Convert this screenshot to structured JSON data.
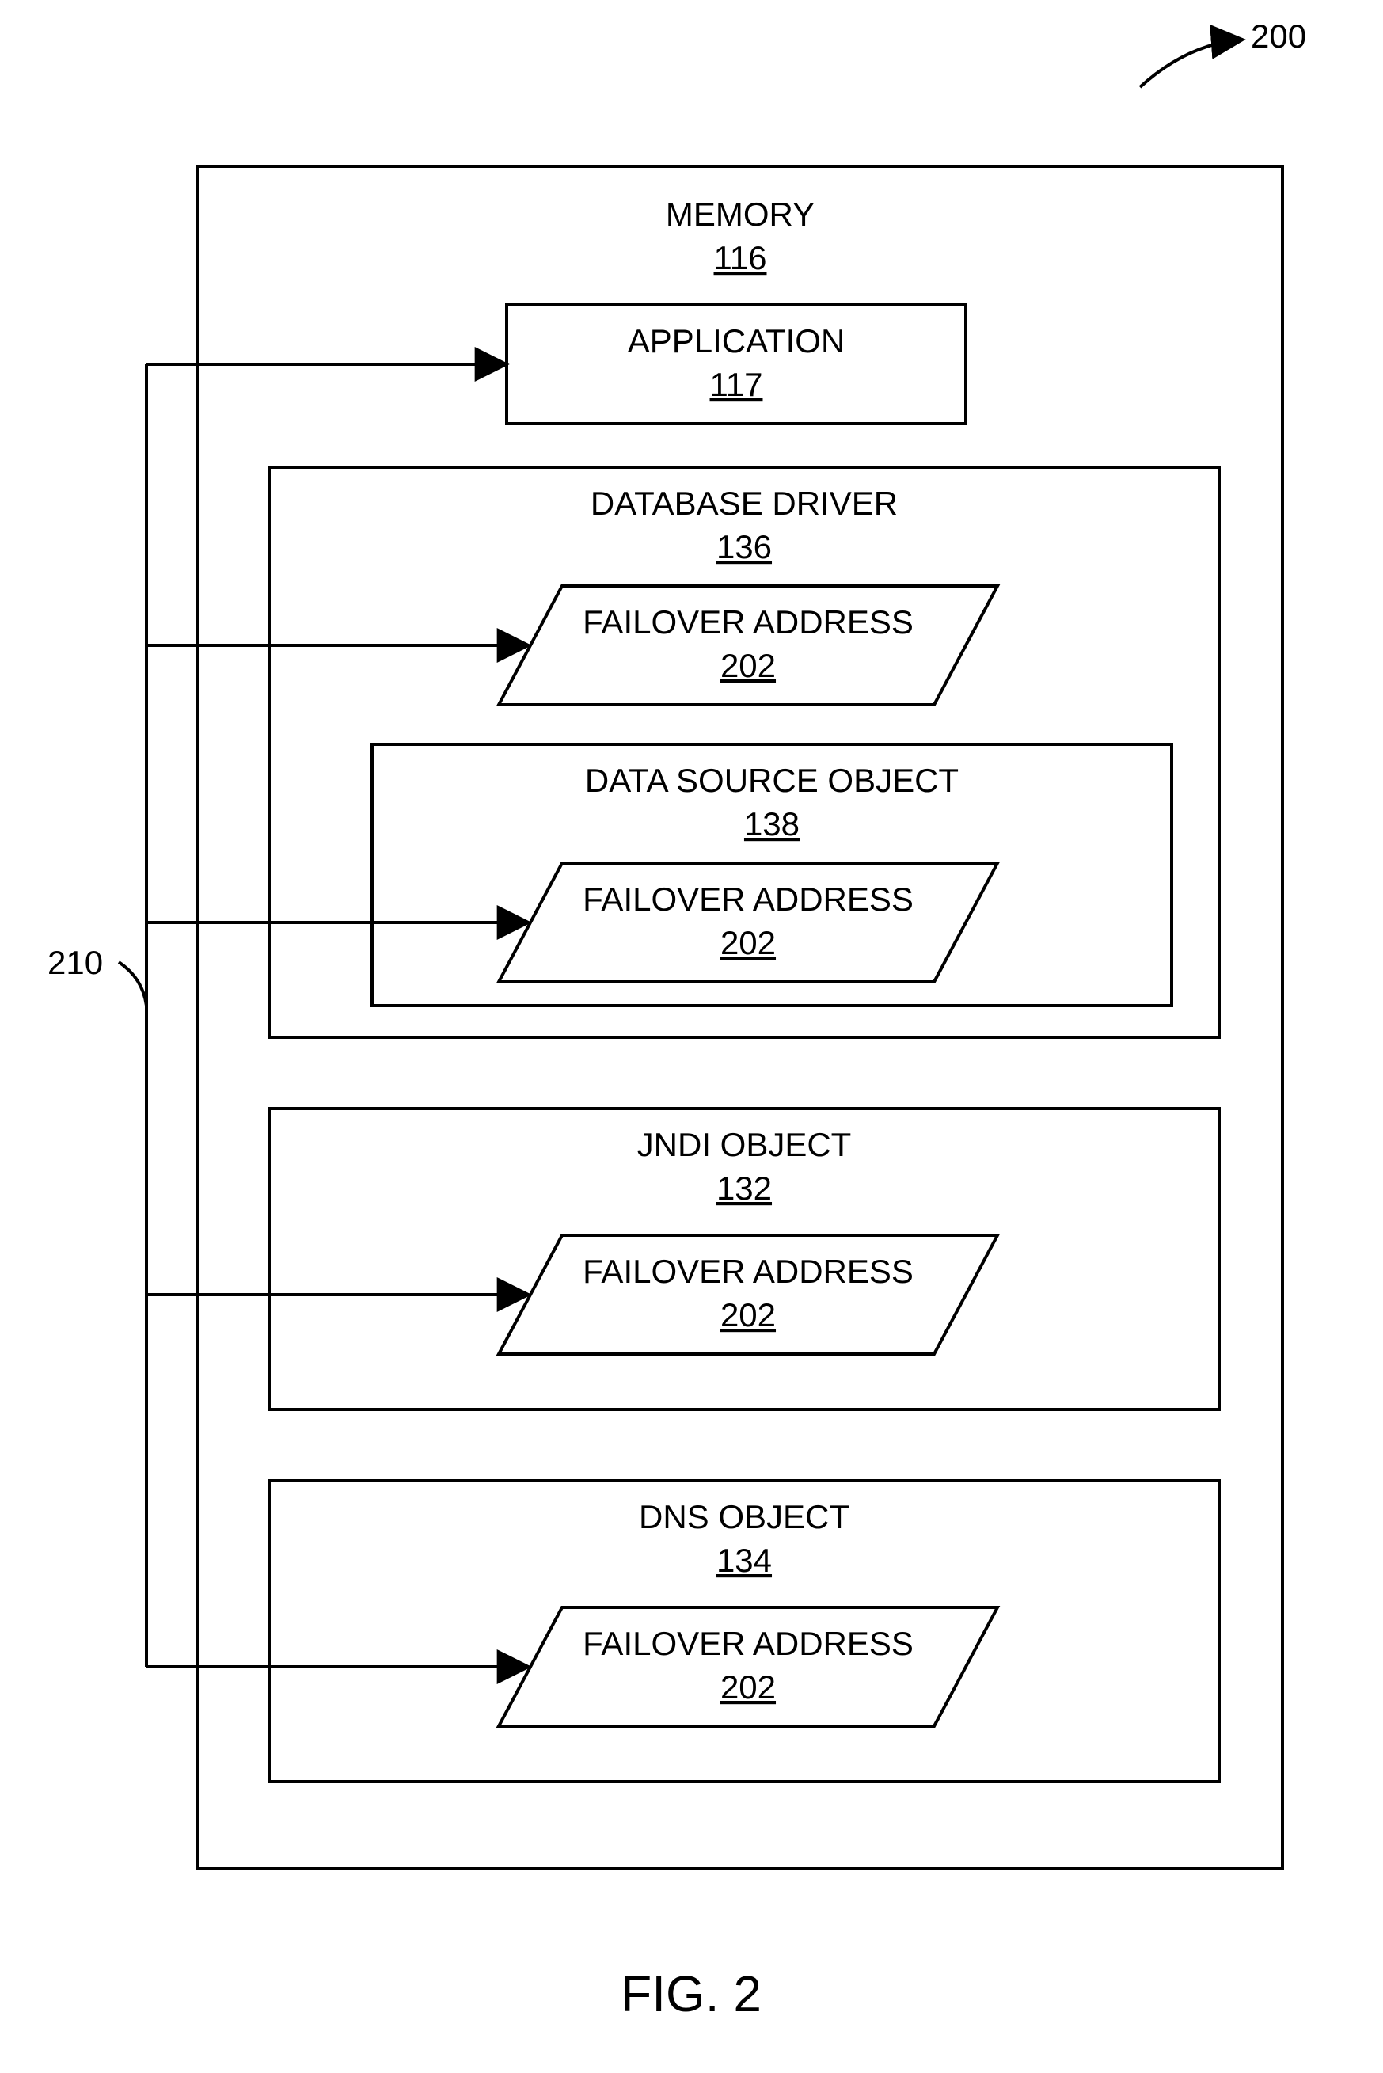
{
  "figure": {
    "label": "FIG. 2",
    "ref_tag": "200",
    "side_ref": "210"
  },
  "memory": {
    "title": "MEMORY",
    "num": "116"
  },
  "application": {
    "title": "APPLICATION",
    "num": "117"
  },
  "db_driver": {
    "title": "DATABASE DRIVER",
    "num": "136"
  },
  "failover": {
    "title": "FAILOVER ADDRESS",
    "num": "202"
  },
  "data_source": {
    "title": "DATA SOURCE OBJECT",
    "num": "138"
  },
  "jndi": {
    "title": "JNDI  OBJECT",
    "num": "132"
  },
  "dns": {
    "title": "DNS  OBJECT",
    "num": "134"
  },
  "chart_data": {
    "type": "block-diagram",
    "nodes": [
      {
        "id": "memory",
        "label": "MEMORY",
        "ref": "116",
        "children": [
          "application",
          "db_driver",
          "data_source",
          "jndi",
          "dns"
        ]
      },
      {
        "id": "application",
        "label": "APPLICATION",
        "ref": "117"
      },
      {
        "id": "db_driver",
        "label": "DATABASE DRIVER",
        "ref": "136",
        "children": [
          "failover_a",
          "data_source"
        ]
      },
      {
        "id": "failover_a",
        "label": "FAILOVER ADDRESS",
        "ref": "202"
      },
      {
        "id": "data_source",
        "label": "DATA SOURCE OBJECT",
        "ref": "138",
        "children": [
          "failover_b"
        ]
      },
      {
        "id": "failover_b",
        "label": "FAILOVER ADDRESS",
        "ref": "202"
      },
      {
        "id": "jndi",
        "label": "JNDI  OBJECT",
        "ref": "132",
        "children": [
          "failover_c"
        ]
      },
      {
        "id": "failover_c",
        "label": "FAILOVER ADDRESS",
        "ref": "202"
      },
      {
        "id": "dns",
        "label": "DNS  OBJECT",
        "ref": "134",
        "children": [
          "failover_d"
        ]
      },
      {
        "id": "failover_d",
        "label": "FAILOVER ADDRESS",
        "ref": "202"
      }
    ],
    "annotations": {
      "figure_ref": "200",
      "brace_ref": "210"
    },
    "arrows": [
      {
        "from": "210",
        "to": "application"
      },
      {
        "from": "210",
        "to": "failover_a"
      },
      {
        "from": "210",
        "to": "failover_b"
      },
      {
        "from": "210",
        "to": "failover_c"
      },
      {
        "from": "210",
        "to": "failover_d"
      }
    ]
  }
}
